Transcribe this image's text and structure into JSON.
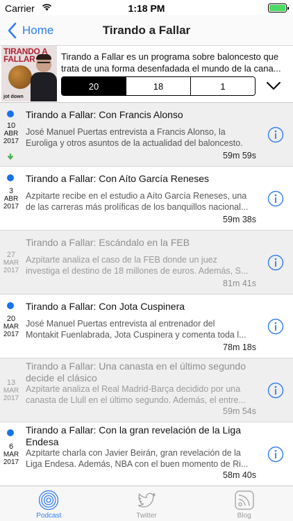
{
  "status_bar": {
    "carrier": "Carrier",
    "time": "1:18 PM"
  },
  "nav": {
    "back_label": "Home",
    "title": "Tirando a Fallar"
  },
  "header": {
    "artwork_title_1": "TIRANDO A",
    "artwork_title_2": "FALLAR",
    "artwork_brand": "jot down",
    "description_line_1": "Tirando a Fallar es un programa sobre baloncesto que",
    "description_line_2": "trata de una forma desenfadada el mundo de la cana...",
    "filter_options": [
      "20",
      "18",
      "1"
    ],
    "selected_filter": "20"
  },
  "episodes": [
    {
      "day": "10",
      "month": "ABR",
      "year": "2017",
      "title": "Tirando a Fallar: Con Francis Alonso",
      "desc_1": "José Manuel Puertas entrevista a Francis Alonso, la",
      "desc_2": "Euroliga y otros asuntos de la actualidad del baloncesto.",
      "duration": "59m 59s",
      "new": true,
      "downloaded": true,
      "played": false
    },
    {
      "day": "3",
      "month": "ABR",
      "year": "2017",
      "title": "Tirando a Fallar: Con Aíto García Reneses",
      "desc_1": "Azpitarte recibe en el estudio a Aíto García Reneses, una",
      "desc_2": "de las carreras más prolíficas de los banquillos nacional...",
      "duration": "59m 38s",
      "new": true,
      "downloaded": false,
      "played": false
    },
    {
      "day": "27",
      "month": "MAR",
      "year": "2017",
      "title": "Tirando a Fallar: Escándalo en la FEB",
      "desc_1": "Azpitarte analiza el caso de la FEB donde un juez",
      "desc_2": "investiga el destino de 18 millones de euros. Además, S...",
      "duration": "81m 41s",
      "new": false,
      "downloaded": false,
      "played": true
    },
    {
      "day": "20",
      "month": "MAR",
      "year": "2017",
      "title": "Tirando a Fallar: Con Jota Cuspinera",
      "desc_1": "José Manuel Puertas entrevista al entrenador del",
      "desc_2": "Montakit Fuenlabrada, Jota Cuspinera y comenta toda l...",
      "duration": "78m 18s",
      "new": true,
      "downloaded": false,
      "played": false
    },
    {
      "day": "13",
      "month": "MAR",
      "year": "2017",
      "title": "Tirando a Fallar: Una canasta en el último segundo",
      "title_2": "decide el clásico",
      "desc_1": "Azpitarte analiza el Real Madrid-Barça decidido por una",
      "desc_2": "canasta de Llull en el último segundo. Además, el entre...",
      "duration": "59m 54s",
      "new": false,
      "downloaded": false,
      "played": true
    },
    {
      "day": "6",
      "month": "MAR",
      "year": "2017",
      "title": "Tirando a Fallar: Con la gran revelación de la Liga",
      "title_2": "Endesa",
      "desc_1": "Azpitarte charla con Javier Beirán, gran revelación de la",
      "desc_2": "Liga Endesa. Además, NBA con el buen momento de Ri...",
      "duration": "58m 40s",
      "new": true,
      "downloaded": false,
      "played": false
    }
  ],
  "tabs": [
    {
      "label": "Podcast",
      "icon": "podcast-icon",
      "active": true
    },
    {
      "label": "Twitter",
      "icon": "twitter-icon",
      "active": false
    },
    {
      "label": "Blog",
      "icon": "rss-icon",
      "active": false
    }
  ],
  "colors": {
    "accent": "#2f7cf6",
    "new_dot": "#1a73e8",
    "download": "#4caf50",
    "battery": "#4cd964"
  }
}
